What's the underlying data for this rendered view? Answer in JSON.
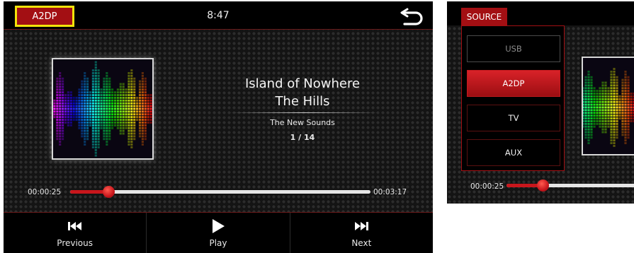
{
  "main": {
    "source_button": "A2DP",
    "clock": "8:47",
    "track": {
      "song": "Island of Nowhere",
      "artist": "The Hills",
      "album": "The New Sounds",
      "position": "1 / 14"
    },
    "progress": {
      "current": "00:00:25",
      "total": "00:03:17",
      "fraction": 0.127
    },
    "controls": {
      "previous": "Previous",
      "play": "Play",
      "next": "Next"
    }
  },
  "source_menu": {
    "tab_label": "SOURCE",
    "items": [
      {
        "label": "USB",
        "state": "disabled"
      },
      {
        "label": "A2DP",
        "state": "active"
      },
      {
        "label": "TV",
        "state": "normal"
      },
      {
        "label": "AUX",
        "state": "normal"
      }
    ],
    "current_time": "00:00:25"
  },
  "colors": {
    "accent_red": "#a30f13",
    "highlight_yellow": "#f4e30a",
    "background": "#141414"
  },
  "icons": {
    "back": "back-arrow-icon",
    "previous": "skip-previous-icon",
    "play": "play-icon",
    "next": "skip-next-icon"
  }
}
